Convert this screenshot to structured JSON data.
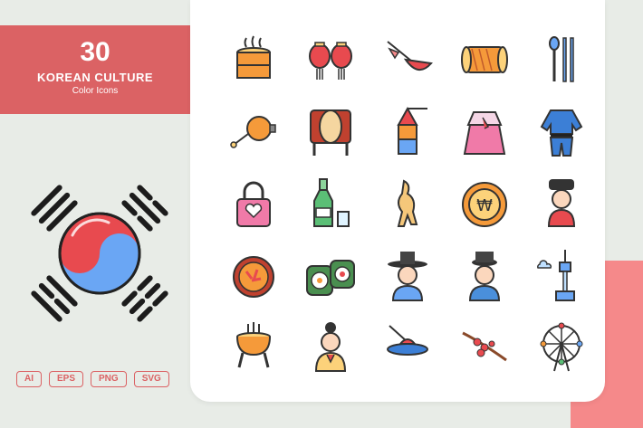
{
  "banner": {
    "count": "30",
    "title": "KOREAN CULTURE",
    "subtitle": "Color Icons"
  },
  "formats": [
    "AI",
    "EPS",
    "PNG",
    "SVG"
  ],
  "colors": {
    "accent": "#db6264",
    "background": "#e8ece7",
    "card": "#ffffff",
    "pink_block": "#f5898a"
  },
  "icons": [
    "steamer-icon",
    "lanterns-icon",
    "boat-icon",
    "drum-icon",
    "spoon-chopsticks-icon",
    "gong-icon",
    "barrel-drum-icon",
    "kite-icon",
    "hanbok-woman-icon",
    "taekwondo-uniform-icon",
    "lock-heart-icon",
    "soju-icon",
    "ginseng-icon",
    "won-coin-icon",
    "woman-headdress-icon",
    "bibimbap-icon",
    "kimbap-icon",
    "man-gat-hat-icon",
    "scholar-hat-icon",
    "seoul-tower-icon",
    "incense-burner-icon",
    "woman-hair-bun-icon",
    "pond-icon",
    "cherry-blossom-icon",
    "ferris-wheel-icon"
  ]
}
